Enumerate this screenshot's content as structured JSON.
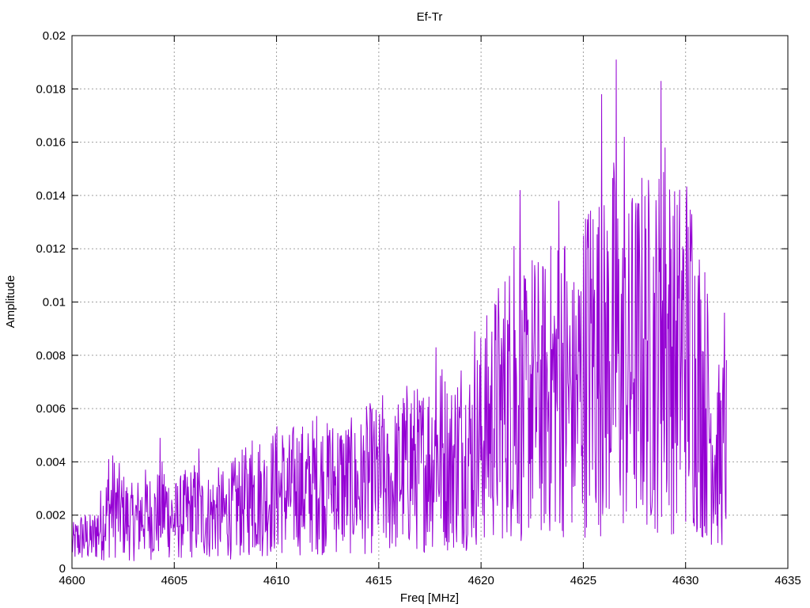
{
  "chart_data": {
    "type": "line",
    "title": "Ef-Tr",
    "xlabel": "Freq [MHz]",
    "ylabel": "Amplitude",
    "xlim": [
      4600,
      4635
    ],
    "ylim": [
      0,
      0.02
    ],
    "xticks": [
      "4600",
      "4605",
      "4610",
      "4615",
      "4620",
      "4625",
      "4630",
      "4635"
    ],
    "yticks": [
      "0",
      "0.002",
      "0.004",
      "0.006",
      "0.008",
      "0.01",
      "0.012",
      "0.014",
      "0.016",
      "0.018",
      "0.02"
    ],
    "grid": true,
    "legend": "none",
    "series": [
      {
        "color": "#9400d3",
        "x": [
          4600.0,
          4600.5,
          4601.0,
          4601.5,
          4602.0,
          4602.5,
          4603.0,
          4603.5,
          4604.0,
          4604.5,
          4605.0,
          4605.5,
          4606.0,
          4606.5,
          4607.0,
          4607.5,
          4608.0,
          4608.5,
          4609.0,
          4609.5,
          4610.0,
          4610.5,
          4611.0,
          4611.5,
          4612.0,
          4612.5,
          4613.0,
          4613.5,
          4614.0,
          4614.5,
          4615.0,
          4615.5,
          4616.0,
          4616.5,
          4617.0,
          4617.5,
          4618.0,
          4618.5,
          4619.0,
          4619.5,
          4620.0,
          4620.5,
          4621.0,
          4621.5,
          4622.0,
          4622.5,
          4623.0,
          4623.5,
          4624.0,
          4624.5,
          4625.0,
          4625.5,
          4626.0,
          4626.5,
          4627.0,
          4627.5,
          4628.0,
          4628.5,
          4629.0,
          4629.5,
          4630.0,
          4630.5,
          4631.0,
          4631.5,
          4632.0
        ],
        "y": [
          0.0009,
          0.0012,
          0.0011,
          0.0018,
          0.0024,
          0.002,
          0.0017,
          0.0021,
          0.0019,
          0.0023,
          0.0018,
          0.002,
          0.0022,
          0.0019,
          0.0021,
          0.002,
          0.0023,
          0.0025,
          0.0028,
          0.0026,
          0.003,
          0.0027,
          0.0031,
          0.0029,
          0.0033,
          0.003,
          0.0032,
          0.0031,
          0.003,
          0.0034,
          0.0033,
          0.0029,
          0.0036,
          0.0039,
          0.0037,
          0.0041,
          0.0044,
          0.0038,
          0.0045,
          0.0043,
          0.0049,
          0.0055,
          0.0061,
          0.0065,
          0.0058,
          0.0066,
          0.0063,
          0.0068,
          0.0072,
          0.006,
          0.0074,
          0.0082,
          0.0076,
          0.0085,
          0.0071,
          0.0079,
          0.0083,
          0.008,
          0.0088,
          0.0078,
          0.0085,
          0.0073,
          0.0062,
          0.0041,
          0.0045
        ],
        "peaks": [
          {
            "x": 4601.8,
            "y": 0.0041
          },
          {
            "x": 4604.3,
            "y": 0.0049
          },
          {
            "x": 4606.2,
            "y": 0.0045
          },
          {
            "x": 4608.8,
            "y": 0.0048
          },
          {
            "x": 4610.3,
            "y": 0.005
          },
          {
            "x": 4612.6,
            "y": 0.0052
          },
          {
            "x": 4615.2,
            "y": 0.0065
          },
          {
            "x": 4616.6,
            "y": 0.0062
          },
          {
            "x": 4617.8,
            "y": 0.0083
          },
          {
            "x": 4619.7,
            "y": 0.0089
          },
          {
            "x": 4621.6,
            "y": 0.0121
          },
          {
            "x": 4621.9,
            "y": 0.0142
          },
          {
            "x": 4623.8,
            "y": 0.0138
          },
          {
            "x": 4624.1,
            "y": 0.0121
          },
          {
            "x": 4625.2,
            "y": 0.0131
          },
          {
            "x": 4625.9,
            "y": 0.0178
          },
          {
            "x": 4626.6,
            "y": 0.0191
          },
          {
            "x": 4627.0,
            "y": 0.0162
          },
          {
            "x": 4627.4,
            "y": 0.0139
          },
          {
            "x": 4628.2,
            "y": 0.0137
          },
          {
            "x": 4628.8,
            "y": 0.0183
          },
          {
            "x": 4629.0,
            "y": 0.0158
          },
          {
            "x": 4629.3,
            "y": 0.012
          },
          {
            "x": 4630.3,
            "y": 0.0133
          },
          {
            "x": 4631.9,
            "y": 0.0096
          }
        ]
      }
    ]
  }
}
